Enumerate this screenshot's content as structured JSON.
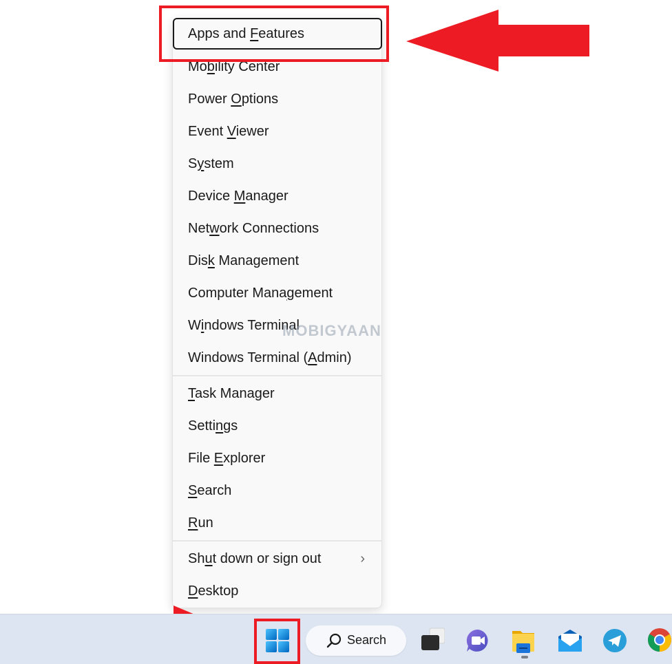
{
  "context_menu": {
    "items": [
      {
        "label_pre": "Apps and ",
        "accel": "F",
        "label_post": "eatures",
        "focused": true
      },
      {
        "label_pre": "Mo",
        "accel": "b",
        "label_post": "ility Center"
      },
      {
        "label_pre": "Power ",
        "accel": "O",
        "label_post": "ptions"
      },
      {
        "label_pre": "Event ",
        "accel": "V",
        "label_post": "iewer"
      },
      {
        "label_pre": "S",
        "accel": "y",
        "label_post": "stem"
      },
      {
        "label_pre": "Device ",
        "accel": "M",
        "label_post": "anager"
      },
      {
        "label_pre": "Net",
        "accel": "w",
        "label_post": "ork Connections"
      },
      {
        "label_pre": "Dis",
        "accel": "k",
        "label_post": " Management"
      },
      {
        "label_pre": "Computer Mana",
        "accel": "g",
        "label_post": "ement"
      },
      {
        "label_pre": "W",
        "accel": "i",
        "label_post": "ndows Terminal"
      },
      {
        "label_pre": "Windows Terminal (",
        "accel": "A",
        "label_post": "dmin)"
      },
      {
        "label_pre": "",
        "accel": "T",
        "label_post": "ask Manager"
      },
      {
        "label_pre": "Setti",
        "accel": "n",
        "label_post": "gs"
      },
      {
        "label_pre": "File ",
        "accel": "E",
        "label_post": "xplorer"
      },
      {
        "label_pre": "",
        "accel": "S",
        "label_post": "earch"
      },
      {
        "label_pre": "",
        "accel": "R",
        "label_post": "un"
      },
      {
        "label_pre": "Sh",
        "accel": "u",
        "label_post": "t down or sign out",
        "submenu": true
      },
      {
        "label_pre": "",
        "accel": "D",
        "label_post": "esktop"
      }
    ],
    "submenu_chevron": "›"
  },
  "watermark": "MOBIGYAAN",
  "taskbar": {
    "start_icon": "windows-start-icon",
    "search_label": "Search",
    "apps": [
      "task-view-icon",
      "teams-chat-icon",
      "file-explorer-icon",
      "mail-icon",
      "telegram-icon",
      "chrome-icon"
    ]
  },
  "annotation_color": "#ed1c24"
}
